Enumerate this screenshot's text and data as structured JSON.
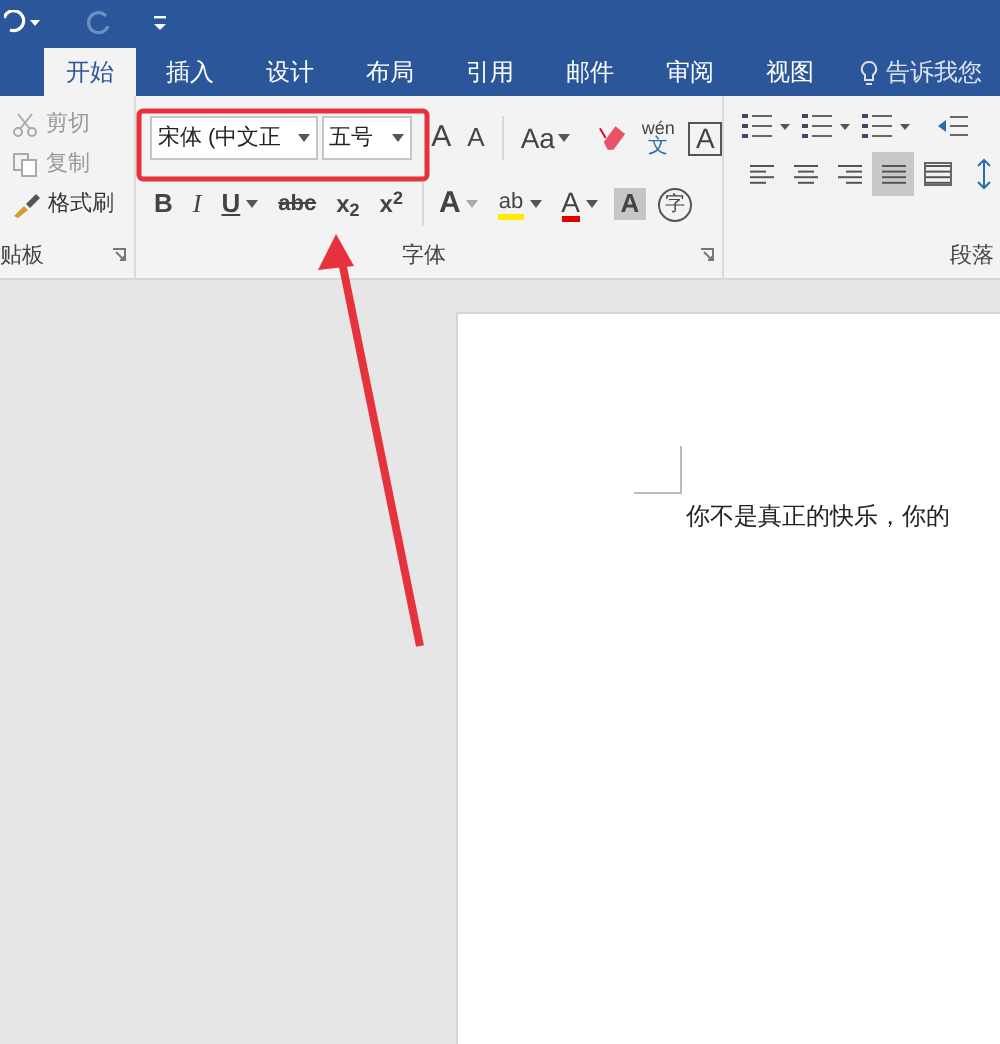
{
  "tabs": [
    {
      "label": "开始",
      "selected": true
    },
    {
      "label": "插入",
      "selected": false
    },
    {
      "label": "设计",
      "selected": false
    },
    {
      "label": "布局",
      "selected": false
    },
    {
      "label": "引用",
      "selected": false
    },
    {
      "label": "邮件",
      "selected": false
    },
    {
      "label": "审阅",
      "selected": false
    },
    {
      "label": "视图",
      "selected": false
    }
  ],
  "tell_me": "告诉我您",
  "clipboard": {
    "items": [
      {
        "kind": "cut",
        "label": "剪切",
        "disabled": true
      },
      {
        "kind": "copy",
        "label": "复制",
        "disabled": true
      },
      {
        "kind": "painter",
        "label": "格式刷",
        "disabled": false
      }
    ],
    "group_label": "贴板"
  },
  "font": {
    "font_name": "宋体 (中文正",
    "font_size": "五号",
    "row1": [
      {
        "kind": "grow",
        "label": "A"
      },
      {
        "kind": "shrink",
        "label": "A"
      },
      {
        "kind": "case",
        "label": "Aa"
      },
      {
        "kind": "clear"
      },
      {
        "kind": "phonetic",
        "label": "wén",
        "sub": "文"
      },
      {
        "kind": "border",
        "label": "A"
      }
    ],
    "row2": [
      {
        "kind": "bold",
        "label": "B"
      },
      {
        "kind": "italic",
        "label": "I"
      },
      {
        "kind": "underline",
        "label": "U"
      },
      {
        "kind": "strike",
        "label": "abc"
      },
      {
        "kind": "sub",
        "label": "x$_{2}$"
      },
      {
        "kind": "sup",
        "label": "x$^{2}$"
      },
      {
        "kind": "effect",
        "label": "A"
      },
      {
        "kind": "highlight",
        "label": "ab"
      },
      {
        "kind": "color",
        "label": "A"
      },
      {
        "kind": "shade",
        "label": "A"
      },
      {
        "kind": "enclose",
        "label": "字"
      }
    ],
    "group_label": "字体"
  },
  "paragraph": {
    "align": [
      {
        "kind": "left",
        "selected": false
      },
      {
        "kind": "center",
        "selected": false
      },
      {
        "kind": "right",
        "selected": false
      },
      {
        "kind": "justify",
        "selected": true
      },
      {
        "kind": "distributed",
        "selected": false
      }
    ],
    "group_label": "段落"
  },
  "document": {
    "text": "你不是真正的快乐，你的"
  }
}
